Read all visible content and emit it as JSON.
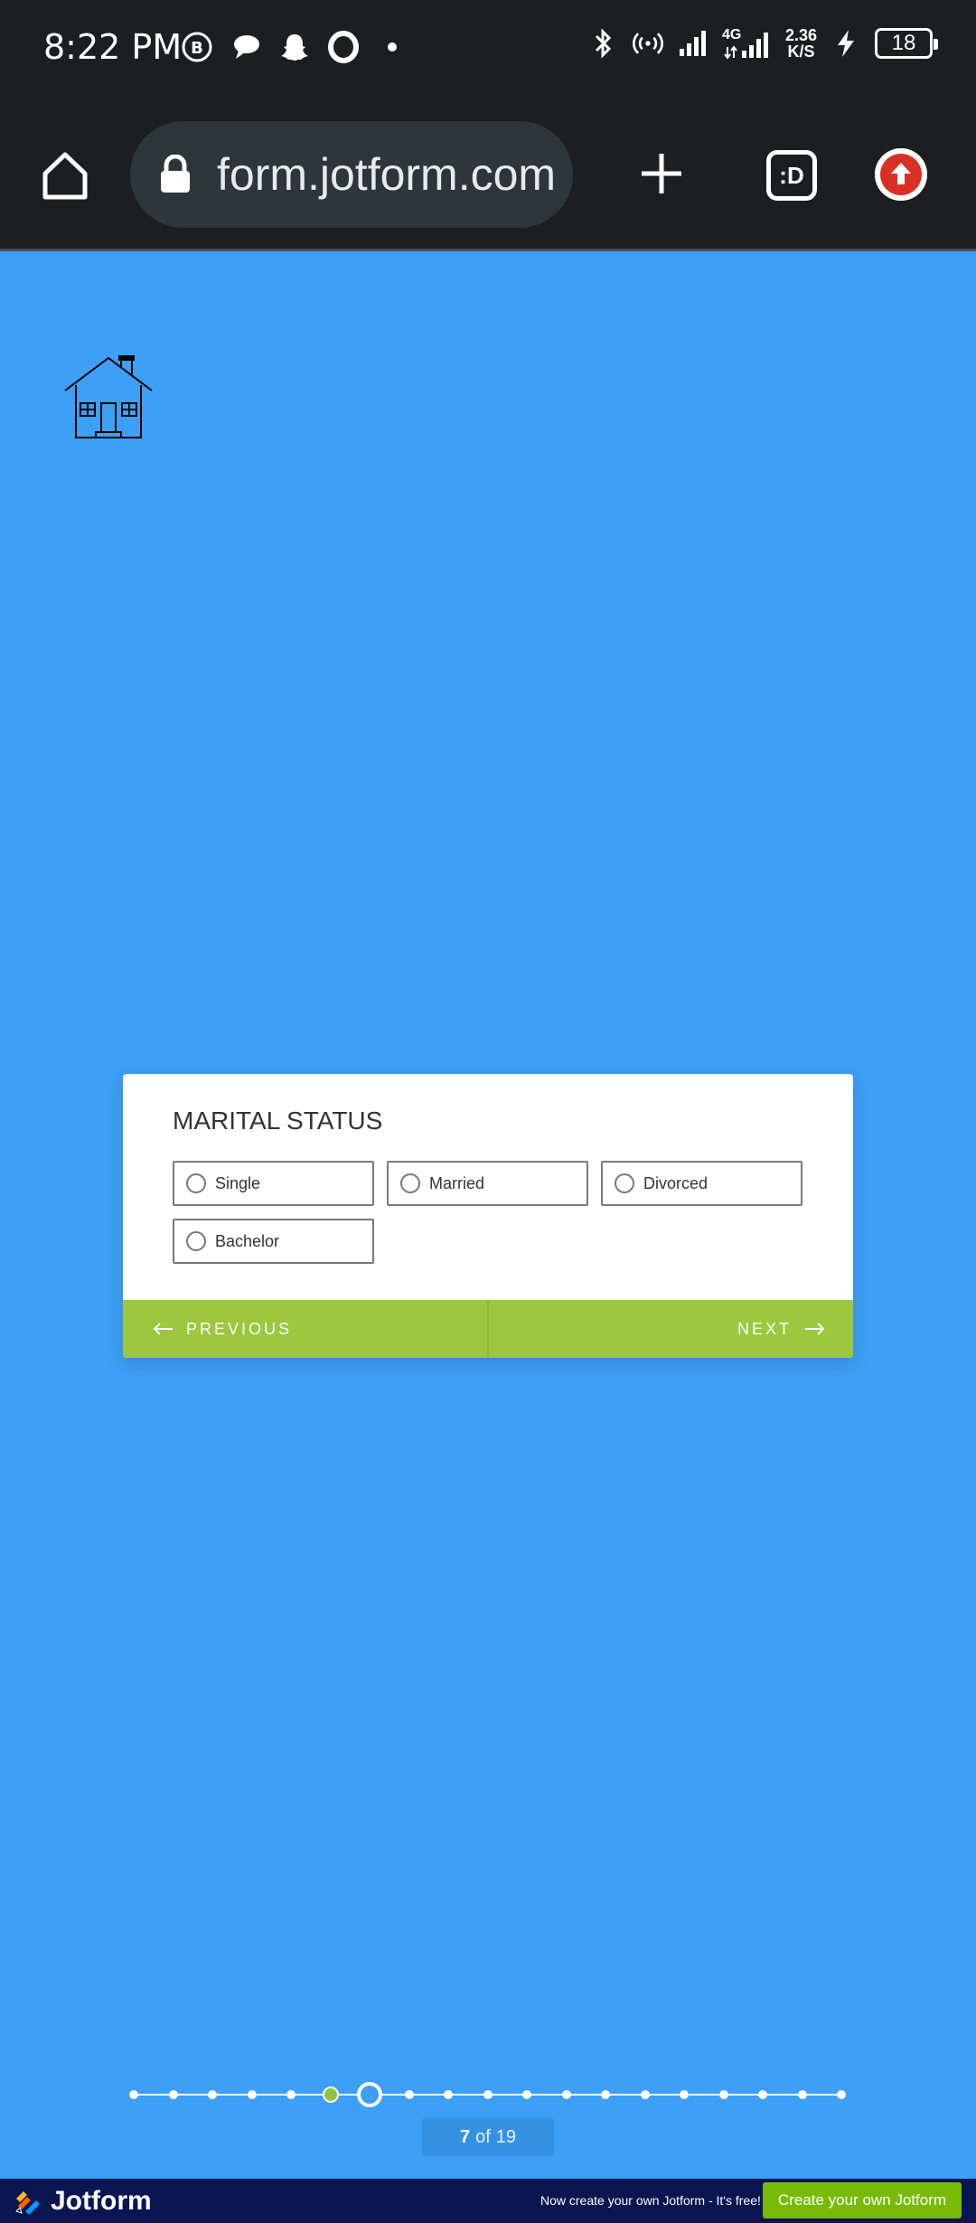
{
  "status_bar": {
    "time": "8:22 PM",
    "network_type": "4G",
    "net_speed_value": "2.36",
    "net_speed_unit": "K/S",
    "battery": "18",
    "left_icons": [
      "b-badge-icon",
      "chat-icon",
      "snapchat-icon",
      "opera-icon",
      "dot-icon"
    ],
    "right_icons": [
      "bluetooth-icon",
      "hotspot-icon",
      "signal-icon",
      "signal-4g-icon",
      "charging-icon"
    ]
  },
  "browser": {
    "url": "form.jotform.com",
    "tabs_label": ":D",
    "icons": [
      "home-icon",
      "lock-icon",
      "plus-icon",
      "tabs-icon",
      "upload-arrow-icon"
    ]
  },
  "form": {
    "question": "MARITAL STATUS",
    "options": [
      "Single",
      "Married",
      "Divorced",
      "Bachelor"
    ],
    "previous_label": "PREVIOUS",
    "next_label": "NEXT"
  },
  "progress": {
    "current": "7",
    "of": "of",
    "total": "19",
    "current_index": 7,
    "total_steps": 19
  },
  "footer": {
    "brand": "Jotform",
    "promo": "Now create your own Jotform - It's free!",
    "cta": "Create your own Jotform",
    "accent": "#78bb07"
  },
  "colors": {
    "background": "#3d9ff5",
    "nav_bar": "#9bc83c",
    "footer_bg": "#0a1551"
  }
}
